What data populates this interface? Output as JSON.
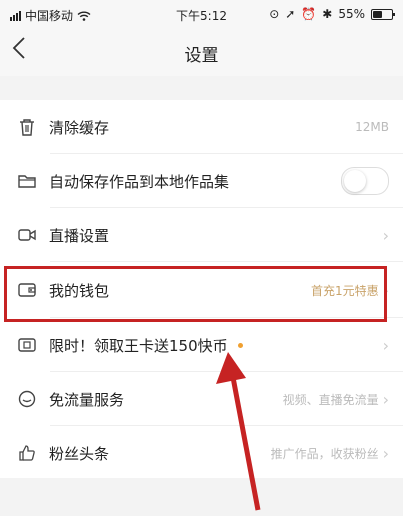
{
  "status_bar": {
    "carrier": "中国移动",
    "time": "下午5:12",
    "battery": "55%",
    "battery_level": 0.55
  },
  "nav": {
    "back_icon": "chevron-left-icon",
    "title": "设置"
  },
  "settings": [
    {
      "key": "clear_cache",
      "icon": "trash-icon",
      "label": "清除缓存",
      "value": "12MB"
    },
    {
      "key": "auto_save",
      "icon": "folder-icon",
      "label": "自动保存作品到本地作品集",
      "toggle": "off"
    },
    {
      "key": "live",
      "icon": "video-camera-icon",
      "label": "直播设置"
    },
    {
      "key": "wallet",
      "icon": "wallet-icon",
      "label": "我的钱包",
      "value": "首充1元特惠",
      "value_color": "#c9a36a"
    },
    {
      "key": "king_card",
      "icon": "card-icon",
      "label": "限时！领取王卡送150快币",
      "badge": "dot"
    },
    {
      "key": "free_data",
      "icon": "smile-circle-icon",
      "label": "免流量服务",
      "value": "视频、直播免流量"
    },
    {
      "key": "fans",
      "icon": "thumbs-up-icon",
      "label": "粉丝头条",
      "value": "推广作品，收获粉丝"
    }
  ],
  "annotations": {
    "highlight_color": "#c62323",
    "arrow_color": "#c62323"
  }
}
